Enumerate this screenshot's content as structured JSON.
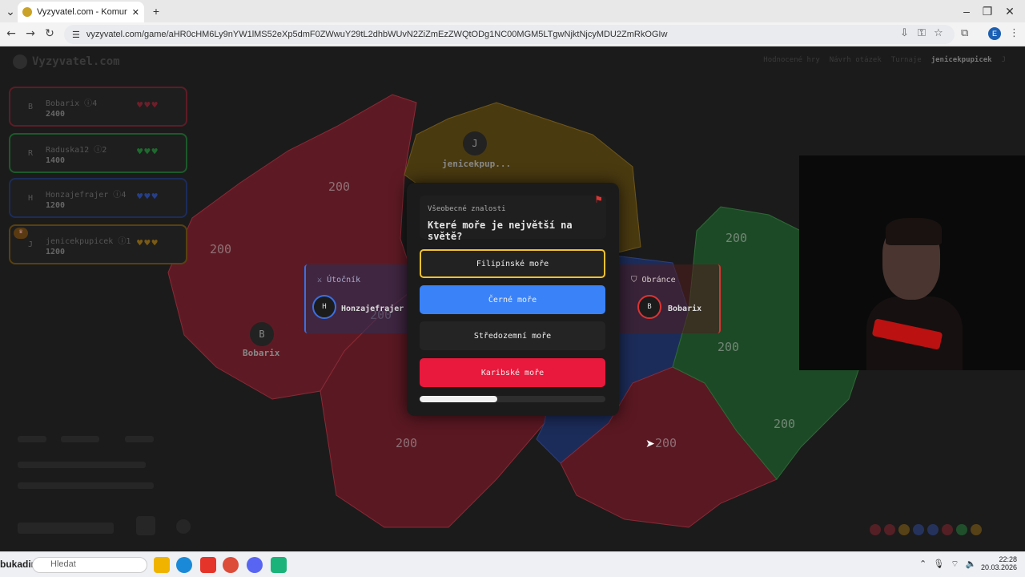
{
  "browser": {
    "tab_title": "Vyzyvatel.com - Komunitní vědo",
    "new_tab_icon": "plus-icon",
    "url": "vyzyvatel.com/game/aHR0cHM6Ly9nYW1lMS52eXp5dmF0ZWwuY29tL2dhbWUvN2ZiZmEzZWQtODg1NC00MGM5LTgwNjktNjcyMDU2ZmRkOGIw",
    "profile_initial": "E"
  },
  "site": {
    "logo": "Vyzyvatel.com",
    "nav": [
      "Hodnocené hry",
      "Návrh otázek",
      "Turnaje"
    ],
    "current_user": "jenicekpupicek",
    "user_initial": "J"
  },
  "players": [
    {
      "initial": "B",
      "name": "Bobarix",
      "level": "4",
      "score": "2400",
      "color": "#c0283a"
    },
    {
      "initial": "R",
      "name": "Raduska12",
      "level": "2",
      "score": "1400",
      "color": "#2ab24a"
    },
    {
      "initial": "H",
      "name": "Honzajefrajer",
      "level": "4",
      "score": "1200",
      "color": "#3a62d8"
    },
    {
      "initial": "J",
      "name": "jenicekpupicek",
      "level": "1",
      "score": "1200",
      "color": "#c88a12"
    }
  ],
  "map": {
    "region_values": [
      "200",
      "200",
      "200",
      "200",
      "200",
      "200",
      "200",
      "200"
    ],
    "avatars": [
      {
        "initial": "J",
        "name": "jenicekpup..."
      },
      {
        "initial": "B",
        "name": "Bobarix"
      }
    ]
  },
  "battle": {
    "attacker_label": "Útočník",
    "attacker_initial": "H",
    "attacker_name": "Honzajefrajer",
    "defender_label": "Obránce",
    "defender_initial": "B",
    "defender_name": "Bobarix"
  },
  "question": {
    "category": "Všeobecné znalosti",
    "text": "Které moře je největší na světě?",
    "answers": [
      "Filipínské moře",
      "Černé moře",
      "Středozemní moře",
      "Karibské moře"
    ],
    "time_remaining_fraction": 0.42
  },
  "taskbar": {
    "user_fragment": "bukadim",
    "search_placeholder": "Hledat",
    "time": "22:28",
    "date": "20.03.2026"
  },
  "colors": {
    "red": "#c0283a",
    "green": "#2ab24a",
    "blue": "#3a62d8",
    "yellow": "#c88a12",
    "answer_blue": "#3a82f7",
    "answer_red": "#e8193c",
    "selected_border": "#f2c230"
  }
}
